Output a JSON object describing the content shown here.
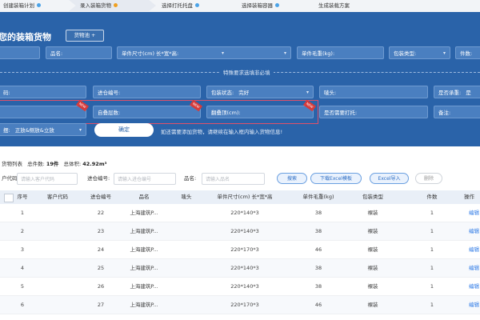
{
  "steps": [
    {
      "label": "创建装箱计划",
      "dot_color": "#4ba3e8",
      "active": false
    },
    {
      "label": "录入装箱货物",
      "dot_color": "#f0a020",
      "active": true
    },
    {
      "label": "选择打托托盘",
      "dot_color": "#4ba3e8",
      "active": false
    },
    {
      "label": "选择装箱容器",
      "dot_color": "#4ba3e8",
      "active": false
    },
    {
      "label": "生成装载方案",
      "dot_color": "",
      "active": false
    }
  ],
  "panel": {
    "title": "您的装箱货物",
    "title_button": "货物池 +",
    "row1": {
      "product_name_label": "品名:",
      "size_label": "单件尺寸(cm) 长*宽*高:",
      "weight_label": "单件毛重(kg):",
      "pack_type_label": "包装类型:",
      "count_label": "件数:"
    },
    "section_label": "特殊要求选填非必填",
    "row2": {
      "code_label": "码:",
      "inbound_label": "进仓编号:",
      "pack_state_label": "包装状态:",
      "pack_state_value": "完好",
      "marks_label": "唛头:",
      "bearing_label": "是否承重:",
      "bearing_value": "是"
    },
    "row3": {
      "stack_layers_label": "自叠层数:",
      "overhang_label": "翻叠顶(cm):",
      "tray_label": "是否需要打托:",
      "note_label": "备注:"
    },
    "row4": {
      "place_label": "摆:",
      "place_value": "正放&侧放&立放",
      "confirm_button": "确定",
      "hint": "如还需要添加货物，请继续在输入框内输入货物信息!"
    }
  },
  "list": {
    "summary": {
      "title": "货物列表",
      "total_count_label": "总件数:",
      "total_count_value": "19件",
      "total_volume_label": "总体积:",
      "total_volume_value": "42.92m³"
    },
    "search": {
      "customer_label": "户代码:",
      "customer_placeholder": "请输入客户代码",
      "inbound_label": "进仓编号:",
      "inbound_placeholder": "请输入进仓编号",
      "name_label": "品名:",
      "name_placeholder": "请输入品名"
    },
    "buttons": {
      "search": "搜索",
      "download_template": "下载Excel模板",
      "import_excel": "Excel导入",
      "delete": "删除"
    }
  },
  "table": {
    "headers": [
      "序号",
      "客户代码",
      "进仓编号",
      "品名",
      "唛头",
      "单件尺寸(cm) 长*宽*高",
      "单件毛重(kg)",
      "包装类型",
      "件数",
      "操作"
    ],
    "rows": [
      {
        "seq": "1",
        "customer": "",
        "inbound": "22",
        "name": "上海建筑P...",
        "marks": "",
        "size": "220*140*3",
        "weight": "38",
        "pack": "裸装",
        "count": "1",
        "action": "编辑"
      },
      {
        "seq": "2",
        "customer": "",
        "inbound": "23",
        "name": "上海建筑P...",
        "marks": "",
        "size": "220*140*3",
        "weight": "38",
        "pack": "裸装",
        "count": "1",
        "action": "编辑"
      },
      {
        "seq": "3",
        "customer": "",
        "inbound": "24",
        "name": "上海建筑P...",
        "marks": "",
        "size": "220*170*3",
        "weight": "46",
        "pack": "裸装",
        "count": "1",
        "action": "编辑"
      },
      {
        "seq": "4",
        "customer": "",
        "inbound": "25",
        "name": "上海建筑P...",
        "marks": "",
        "size": "220*140*3",
        "weight": "38",
        "pack": "裸装",
        "count": "1",
        "action": "编辑"
      },
      {
        "seq": "5",
        "customer": "",
        "inbound": "26",
        "name": "上海建筑P...",
        "marks": "",
        "size": "220*140*3",
        "weight": "38",
        "pack": "裸装",
        "count": "1",
        "action": "编辑"
      },
      {
        "seq": "6",
        "customer": "",
        "inbound": "27",
        "name": "上海建筑P...",
        "marks": "",
        "size": "220*170*3",
        "weight": "46",
        "pack": "裸装",
        "count": "1",
        "action": "编辑"
      }
    ]
  },
  "colors": {
    "panel_bg": "#2a63a9",
    "field_bg": "#4a7fc0",
    "highlight_border": "#e0506a",
    "link": "#2f7be6",
    "tag_red": "#d63b3b"
  }
}
